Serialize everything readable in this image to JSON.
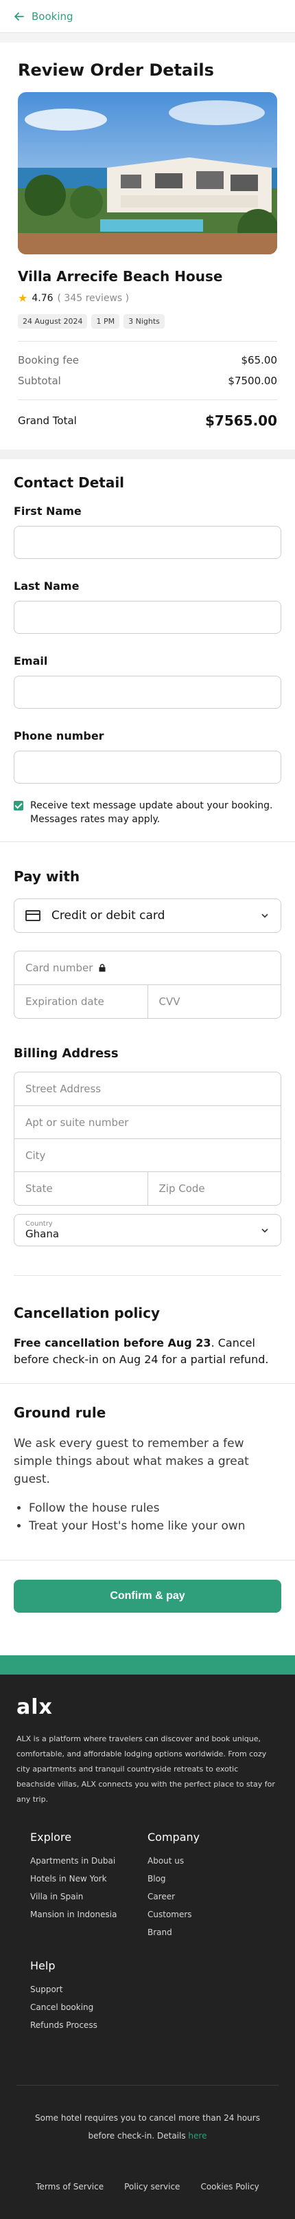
{
  "header": {
    "back_label": "Booking"
  },
  "review": {
    "title": "Review Order Details",
    "property_name": "Villa Arrecife Beach House",
    "rating": "4.76",
    "reviews": "( 345 reviews )",
    "tags": [
      "24 August 2024",
      "1 PM",
      "3 Nights"
    ],
    "booking_fee_label": "Booking fee",
    "booking_fee": "$65.00",
    "subtotal_label": "Subtotal",
    "subtotal": "$7500.00",
    "total_label": "Grand Total",
    "total": "$7565.00"
  },
  "contact": {
    "title": "Contact Detail",
    "first_name_label": "First Name",
    "last_name_label": "Last Name",
    "email_label": "Email",
    "phone_label": "Phone number",
    "sms_text": "Receive text message update about your booking. Messages rates may apply."
  },
  "payment": {
    "title": "Pay with",
    "method": "Credit or debit card",
    "card_number": "Card number",
    "expiration": "Expiration date",
    "cvv": "CVV",
    "billing_title": "Billing Address",
    "street": "Street Address",
    "apt": "Apt or suite number",
    "city": "City",
    "state": "State",
    "zip": "Zip Code",
    "country_label": "Country",
    "country_value": "Ghana"
  },
  "cancellation": {
    "title": "Cancellation policy",
    "bold": "Free cancellation before Aug 23",
    "rest": ". Cancel before check-in on Aug 24 for a partial refund."
  },
  "ground_rule": {
    "title": "Ground rule",
    "intro": "We ask every guest to remember a few simple things about what makes a great guest.",
    "items": [
      "Follow the house rules",
      "Treat your Host's home like your own"
    ]
  },
  "confirm_label": "Confirm & pay",
  "footer": {
    "logo": "alx",
    "about": "ALX is a platform where travelers can discover and book unique, comfortable, and affordable lodging options worldwide. From cozy city apartments and tranquil countryside retreats to exotic beachside villas, ALX connects you with the perfect place to stay for any trip.",
    "explore_title": "Explore",
    "explore": [
      "Apartments in Dubai",
      "Hotels in New York",
      "Villa in Spain",
      "Mansion in Indonesia"
    ],
    "company_title": "Company",
    "company": [
      "About us",
      "Blog",
      "Career",
      "Customers",
      "Brand"
    ],
    "help_title": "Help",
    "help": [
      "Support",
      "Cancel booking",
      "Refunds Process"
    ],
    "notice": "Some hotel requires you to cancel more than 24 hours before check-in. Details ",
    "notice_link": "here",
    "legal": [
      "Terms of Service",
      "Policy service",
      "Cookies Policy"
    ]
  },
  "colors": {
    "accent": "#2f9f7b",
    "footer_bg": "#222222",
    "star": "#f4b400"
  }
}
